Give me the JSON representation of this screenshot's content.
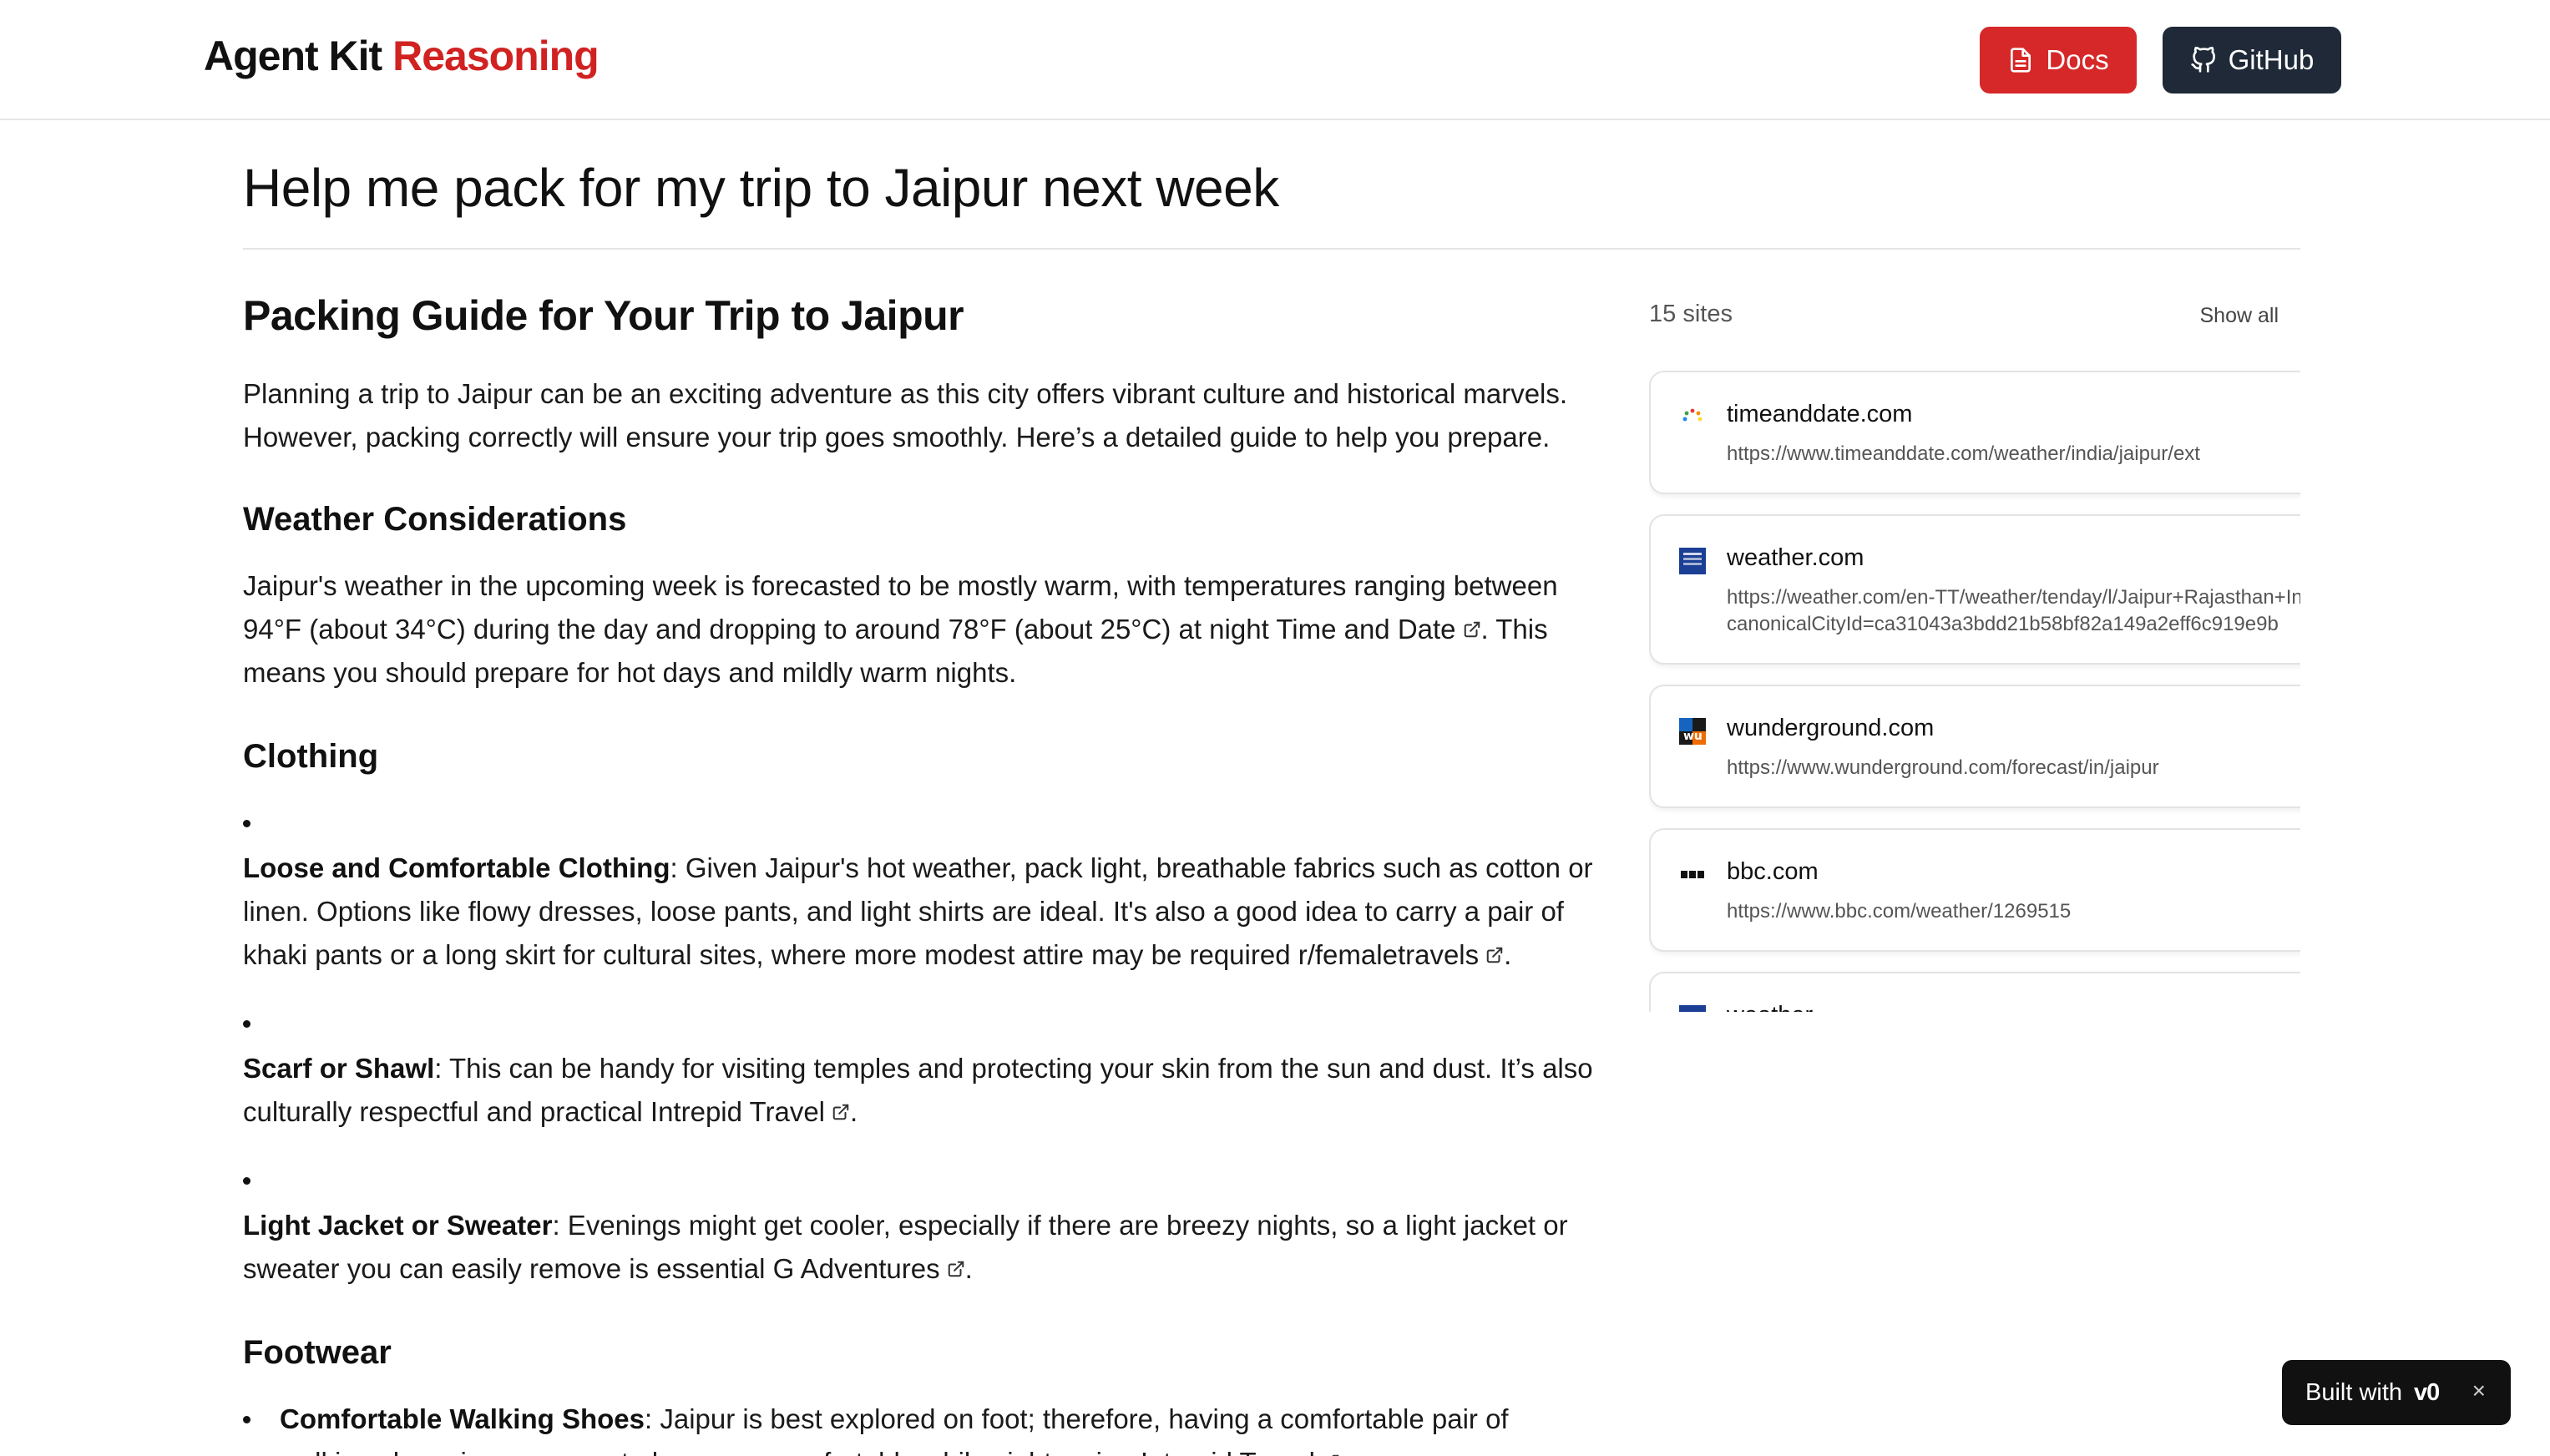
{
  "header": {
    "brand_part1": "Agent Kit",
    "brand_part2": "Reasoning",
    "docs_label": "Docs",
    "github_label": "GitHub"
  },
  "query": "Help me pack for my trip to Jaipur next week",
  "article": {
    "title": "Packing Guide for Your Trip to Jaipur",
    "intro": "Planning a trip to Jaipur can be an exciting adventure as this city offers vibrant culture and historical marvels. However, packing correctly will ensure your trip goes smoothly. Here’s a detailed guide to help you prepare.",
    "weather_heading": "Weather Considerations",
    "weather_text": "Jaipur's weather in the upcoming week is forecasted to be mostly warm, with temperatures ranging between 94°F (about 34°C) during the day and dropping to around 78°F (about 25°C) at night",
    "weather_link": "Time and Date",
    "weather_after": ". This means you should prepare for hot days and mildly warm nights.",
    "clothing_heading": "Clothing",
    "clothing_items": [
      {
        "bold": "Loose and Comfortable Clothing",
        "text": ": Given Jaipur's hot weather, pack light, breathable fabrics such as cotton or linen. Options like flowy dresses, loose pants, and light shirts are ideal. It's also a good idea to carry a pair of khaki pants or a long skirt for cultural sites, where more modest attire may be required",
        "link": "r/femaletravels",
        "after": "."
      },
      {
        "bold": "Scarf or Shawl",
        "text": ": This can be handy for visiting temples and protecting your skin from the sun and dust. It’s also culturally respectful and practical",
        "link": "Intrepid Travel",
        "after": "."
      },
      {
        "bold": "Light Jacket or Sweater",
        "text": ": Evenings might get cooler, especially if there are breezy nights, so a light jacket or sweater you can easily remove is essential",
        "link": "G Adventures",
        "after": "."
      }
    ],
    "footwear_heading": "Footwear",
    "footwear_items": [
      {
        "bold": "Comfortable Walking Shoes",
        "text": ": Jaipur is best explored on foot; therefore, having a comfortable pair of walking shoes is necessary to keep you comfortable while sightseeing",
        "link": "Intrepid Travel",
        "after": "."
      }
    ]
  },
  "sources": {
    "count_label": "15 sites",
    "show_all_label": "Show all",
    "items": [
      {
        "domain": "timeanddate.com",
        "url": "https://www.timeanddate.com/weather/india/jaipur/ext",
        "icon": "timeanddate-favicon"
      },
      {
        "domain": "weather.com",
        "url": "https://weather.com/en-TT/weather/tenday/l/Jaipur+Rajasthan+India?",
        "url2": "canonicalCityId=ca31043a3bdd21b58bf82a149a2eff6c919e9b",
        "icon": "weather-channel-favicon"
      },
      {
        "domain": "wunderground.com",
        "url": "https://www.wunderground.com/forecast/in/jaipur",
        "icon": "wunderground-favicon"
      },
      {
        "domain": "bbc.com",
        "url": "https://www.bbc.com/weather/1269515",
        "icon": "bbc-favicon"
      },
      {
        "domain": "weather",
        "url": "",
        "icon": "weather-favicon"
      }
    ]
  },
  "badge": {
    "label": "Built with",
    "logo": "v0",
    "close": "×"
  },
  "colors": {
    "brand_red": "#d12222",
    "docs_button": "#d62828",
    "github_button": "#1f2937"
  }
}
